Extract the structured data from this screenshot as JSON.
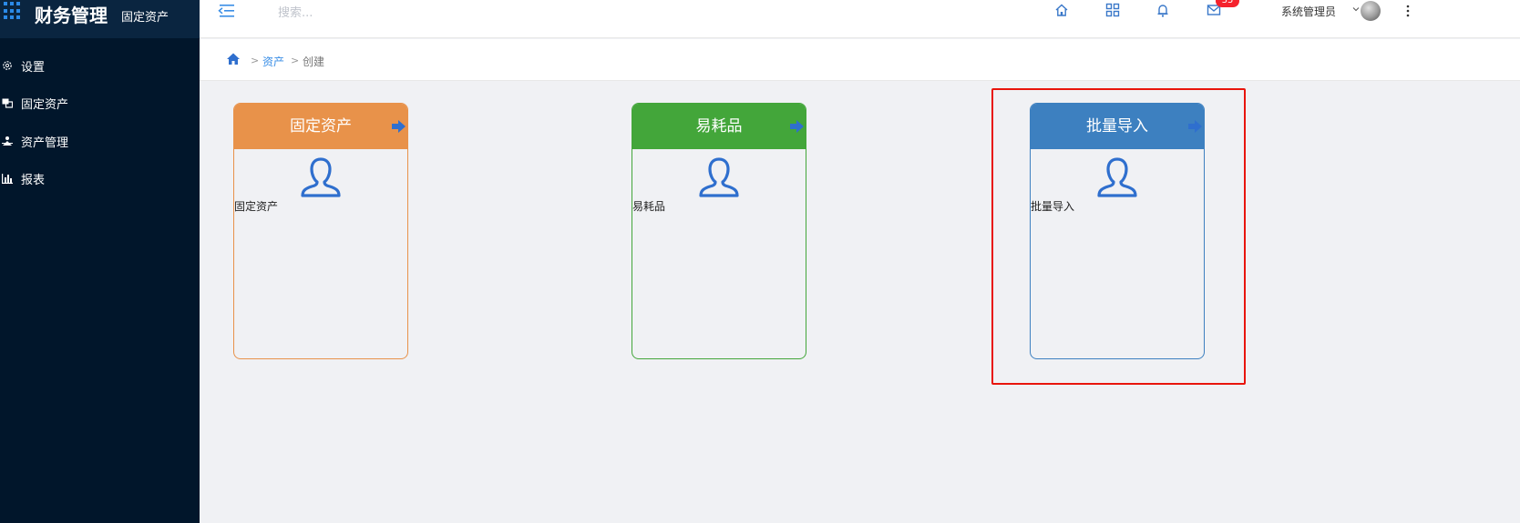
{
  "brand": {
    "title": "财务管理",
    "subtitle": "固定资产"
  },
  "sidebar": {
    "items": [
      {
        "label": "设置",
        "icon": "gear-icon"
      },
      {
        "label": "固定资产",
        "icon": "asset-icon"
      },
      {
        "label": "资产管理",
        "icon": "manage-icon"
      },
      {
        "label": "报表",
        "icon": "chart-icon"
      }
    ]
  },
  "topbar": {
    "search_placeholder": "搜索...",
    "icons": [
      "home-icon",
      "grid-icon",
      "bell-icon",
      "mail-icon"
    ],
    "mail_badge": "35",
    "user_name": "系统管理员"
  },
  "breadcrumb": {
    "link": "资产",
    "current": "创建",
    "separator": ">"
  },
  "cards": [
    {
      "title": "固定资产",
      "label": "固定资产",
      "color": "#e8924a"
    },
    {
      "title": "易耗品",
      "label": "易耗品",
      "color": "#43a63a"
    },
    {
      "title": "批量导入",
      "label": "批量导入",
      "color": "#3d80c0"
    }
  ],
  "colors": {
    "sidebar_bg": "#01162b",
    "accent": "#3a8ee6",
    "highlight": "#e8140c",
    "icon_blue": "#2f6fce"
  }
}
